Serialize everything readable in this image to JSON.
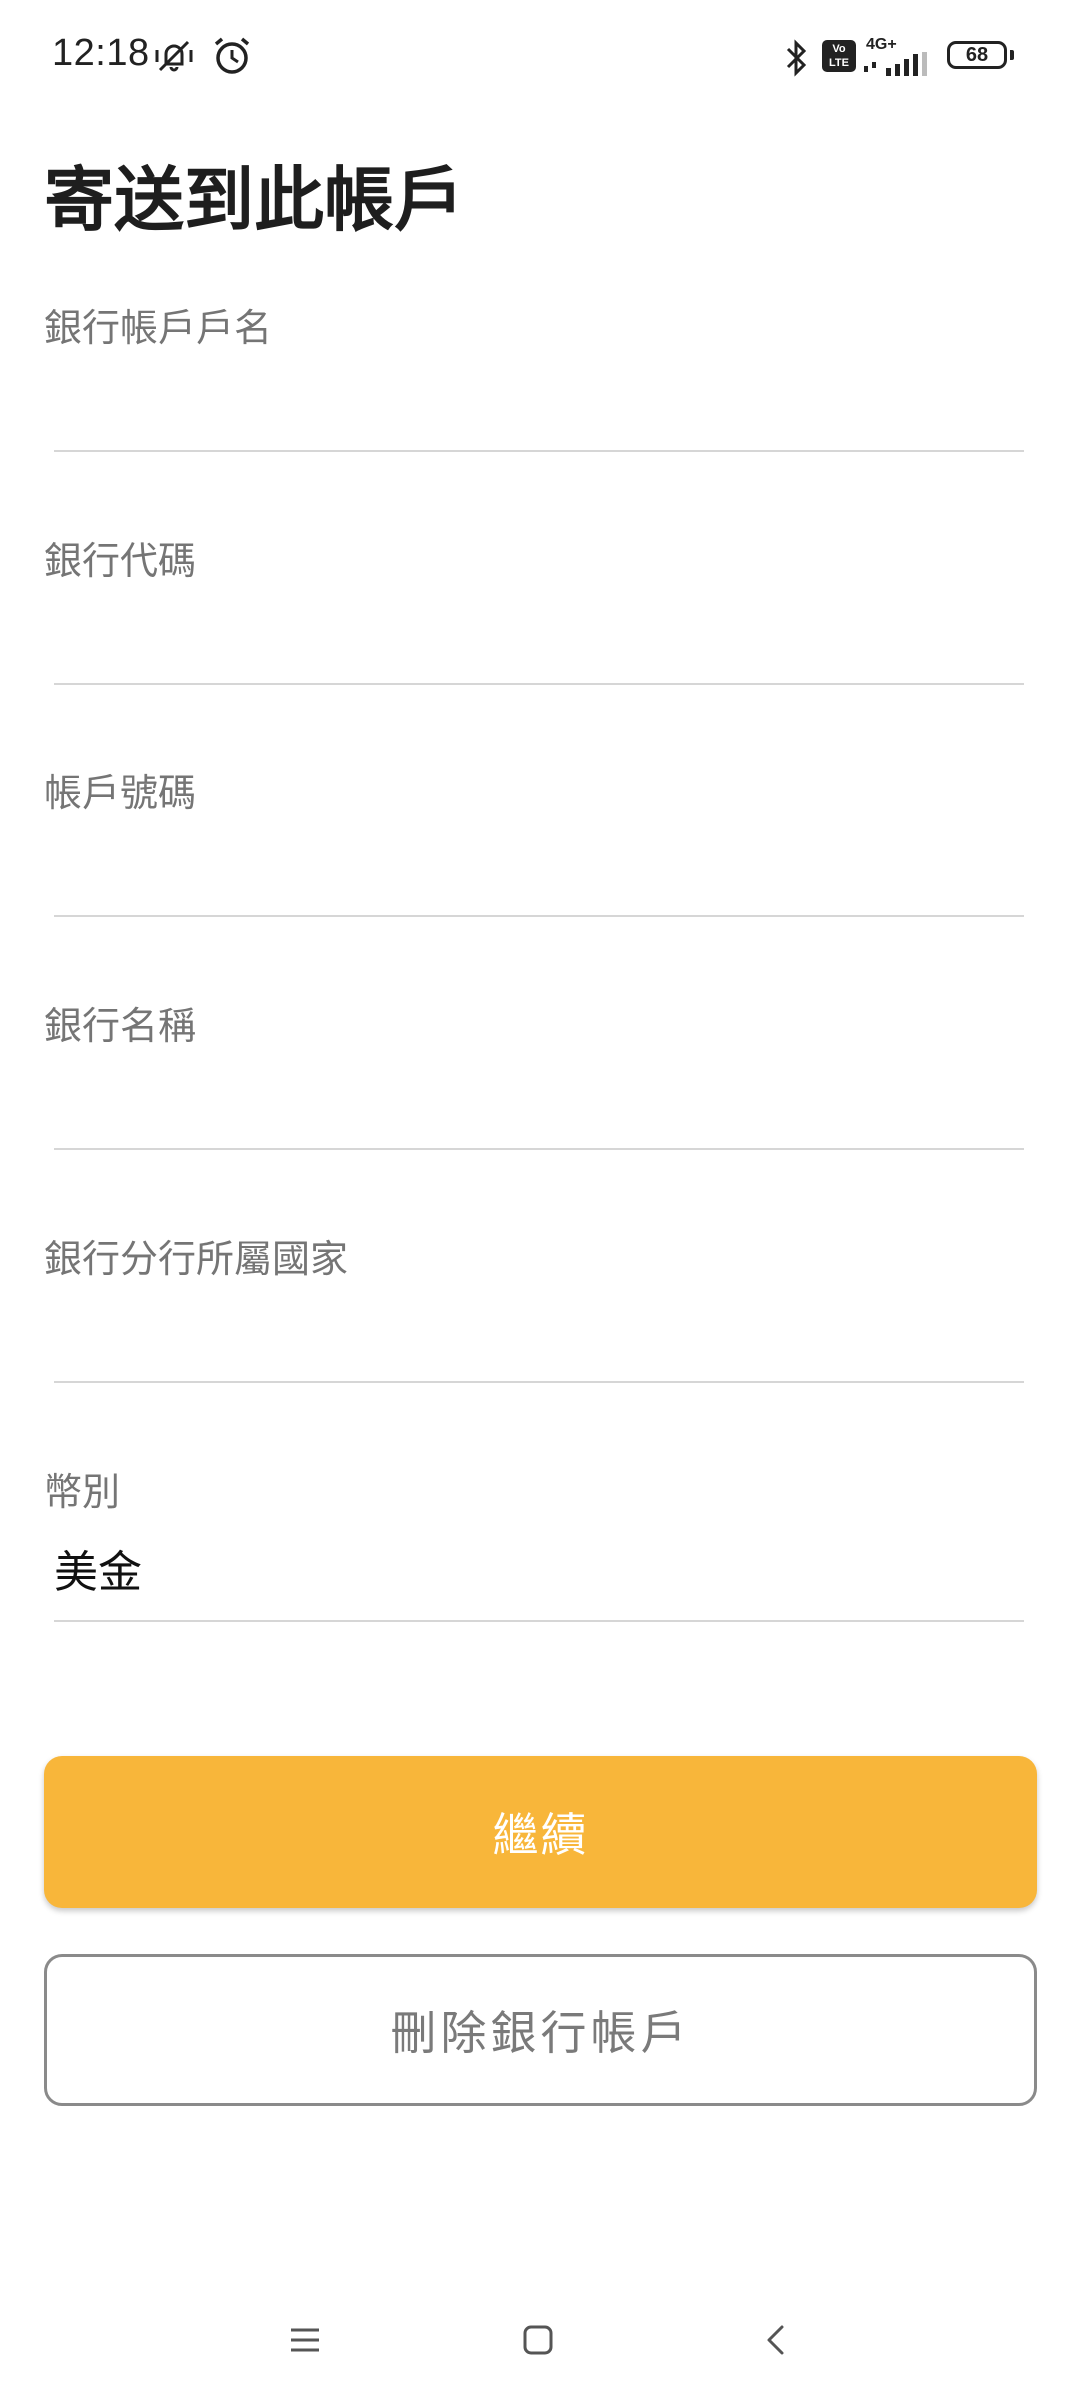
{
  "status_bar": {
    "time": "12:18",
    "icons": [
      "vibrate-off-icon",
      "alarm-icon",
      "bluetooth-icon",
      "volte-icon",
      "signal-icon",
      "battery-icon"
    ],
    "volte_label": "Vo LTE",
    "network_label": "4G+",
    "battery_level": "68"
  },
  "header": {
    "title": "寄送到此帳戶"
  },
  "form": {
    "fields": [
      {
        "label": "銀行帳戶戶名",
        "value": ""
      },
      {
        "label": "銀行代碼",
        "value": ""
      },
      {
        "label": "帳戶號碼",
        "value": ""
      },
      {
        "label": "銀行名稱",
        "value": ""
      },
      {
        "label": "銀行分行所屬國家",
        "value": ""
      },
      {
        "label": "幣別",
        "value": "美金"
      }
    ]
  },
  "actions": {
    "continue_label": "繼續",
    "delete_label": "刪除銀行帳戶"
  },
  "colors": {
    "accent": "#f8b63a",
    "label": "#757575",
    "divider": "#d6d6d6",
    "title": "#1e1e1e"
  },
  "nav_bar": {
    "icons": [
      "menu-icon",
      "home-icon",
      "back-icon"
    ]
  }
}
